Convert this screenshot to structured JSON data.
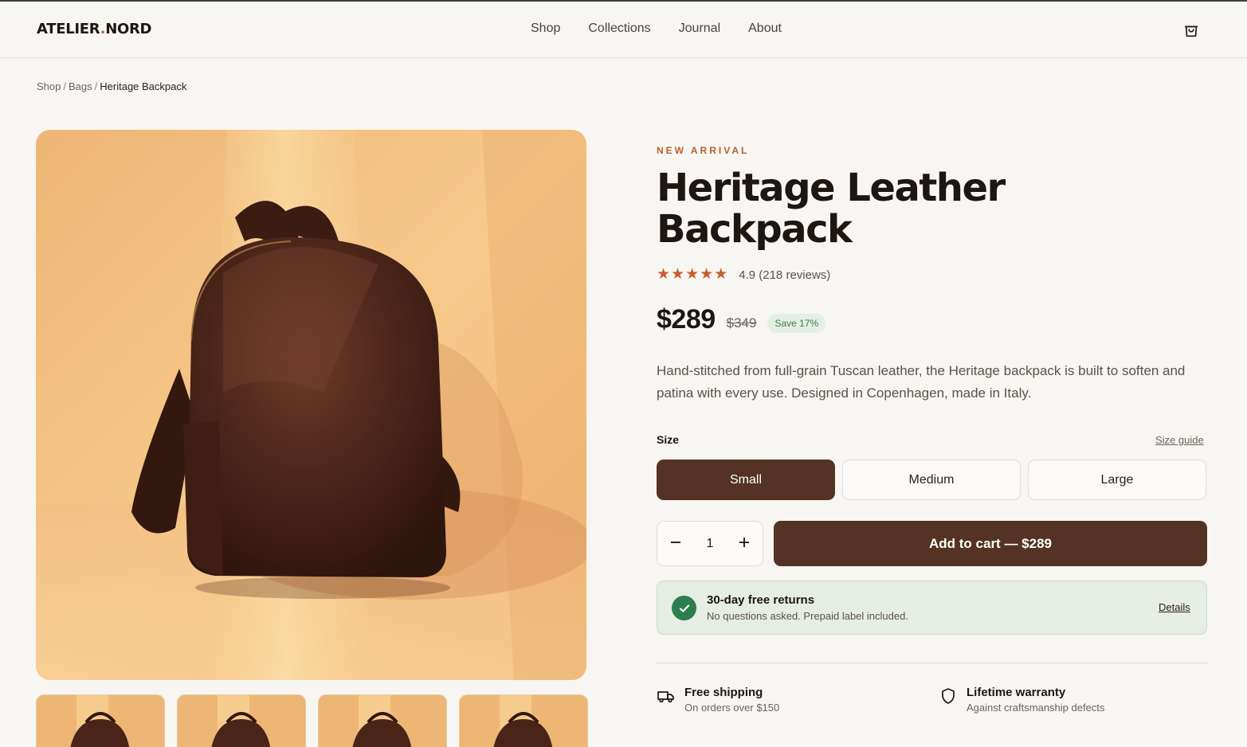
{
  "header": {
    "logo_main": "ATELIER",
    "logo_dot": ".",
    "logo_end": "NORD",
    "nav": [
      "Shop",
      "Collections",
      "Journal",
      "About"
    ],
    "cart_icon": "shopping-bag-icon"
  },
  "breadcrumb": {
    "items": [
      "Shop",
      "Bags"
    ],
    "current": "Heritage Backpack",
    "separator": "/"
  },
  "product": {
    "eyebrow": "NEW ARRIVAL",
    "title": "Heritage Leather Backpack",
    "rating": {
      "value": 4.9,
      "stars": 5,
      "text": "4.9 (218 reviews)"
    },
    "price": "$289",
    "old_price": "$349",
    "save_badge": "Save 17%",
    "description": "Hand-stitched from full-grain Tuscan leather, the Heritage backpack is built to soften and patina with every use. Designed in Copenhagen, made in Italy.",
    "size_label": "Size",
    "size_guide": "Size guide",
    "sizes": [
      "Small",
      "Medium",
      "Large"
    ],
    "selected_size": "Small",
    "quantity": "1",
    "add_to_cart": "Add to cart — $289"
  },
  "returns": {
    "title": "30-day free returns",
    "subtitle": "No questions asked. Prepaid label included.",
    "link": "Details"
  },
  "perks": [
    {
      "title": "Free shipping",
      "subtitle": "On orders over $150",
      "icon": "truck-icon"
    },
    {
      "title": "Lifetime warranty",
      "subtitle": "Against craftsmanship defects",
      "icon": "shield-icon"
    }
  ],
  "colors": {
    "accent": "#c2602f",
    "brand_dark": "#543324",
    "success": "#2e7d4f",
    "background": "#f8f6f2"
  }
}
